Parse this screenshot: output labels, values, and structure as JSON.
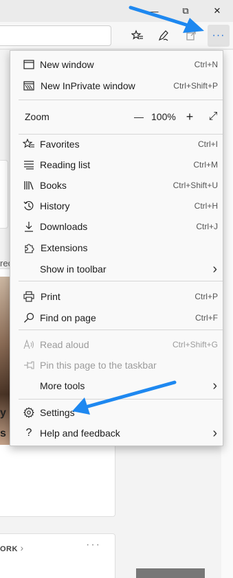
{
  "window": {
    "minimize_glyph": "—",
    "restore_glyph": "⧉",
    "close_glyph": "✕"
  },
  "toolbar": {
    "icons": {
      "favorites": "favorites-star-icon",
      "pen": "pen-icon",
      "share": "share-icon",
      "more": "more-dots-icon"
    },
    "more_glyph": "···"
  },
  "menu": {
    "new_window": {
      "label": "New window",
      "shortcut": "Ctrl+N",
      "icon": "window-icon"
    },
    "new_inprivate": {
      "label": "New InPrivate window",
      "shortcut": "Ctrl+Shift+P",
      "icon": "inprivate-icon"
    },
    "zoom": {
      "label": "Zoom",
      "value": "100%",
      "minus": "—",
      "plus": "+",
      "fullscreen": "⤢"
    },
    "favorites": {
      "label": "Favorites",
      "shortcut": "Ctrl+I",
      "icon": "favorites-icon"
    },
    "reading_list": {
      "label": "Reading list",
      "shortcut": "Ctrl+M",
      "icon": "reading-list-icon"
    },
    "books": {
      "label": "Books",
      "shortcut": "Ctrl+Shift+U",
      "icon": "books-icon"
    },
    "history": {
      "label": "History",
      "shortcut": "Ctrl+H",
      "icon": "history-icon"
    },
    "downloads": {
      "label": "Downloads",
      "shortcut": "Ctrl+J",
      "icon": "download-icon"
    },
    "extensions": {
      "label": "Extensions",
      "icon": "extensions-icon"
    },
    "show_in_toolbar": {
      "label": "Show in toolbar",
      "chevron": "›"
    },
    "print": {
      "label": "Print",
      "shortcut": "Ctrl+P",
      "icon": "print-icon"
    },
    "find_on_page": {
      "label": "Find on page",
      "shortcut": "Ctrl+F",
      "icon": "search-icon"
    },
    "read_aloud": {
      "label": "Read aloud",
      "shortcut": "Ctrl+Shift+G",
      "icon": "read-aloud-icon"
    },
    "pin_taskbar": {
      "label": "Pin this page to the taskbar",
      "icon": "pin-icon"
    },
    "more_tools": {
      "label": "More tools",
      "chevron": "›"
    },
    "settings": {
      "label": "Settings",
      "icon": "gear-icon"
    },
    "help": {
      "label": "Help and feedback",
      "chevron": "›",
      "icon": "help-icon"
    }
  },
  "page": {
    "partial_texts": {
      "t1": "rec",
      "t2": "y I",
      "t3": "s"
    },
    "work_label": "ORK",
    "work_chevron": "›",
    "work_dots": "···"
  },
  "colors": {
    "annotation_arrow": "#1e88f0",
    "menu_bg": "#f9f9f9",
    "disabled_text": "#9b9b9b"
  }
}
